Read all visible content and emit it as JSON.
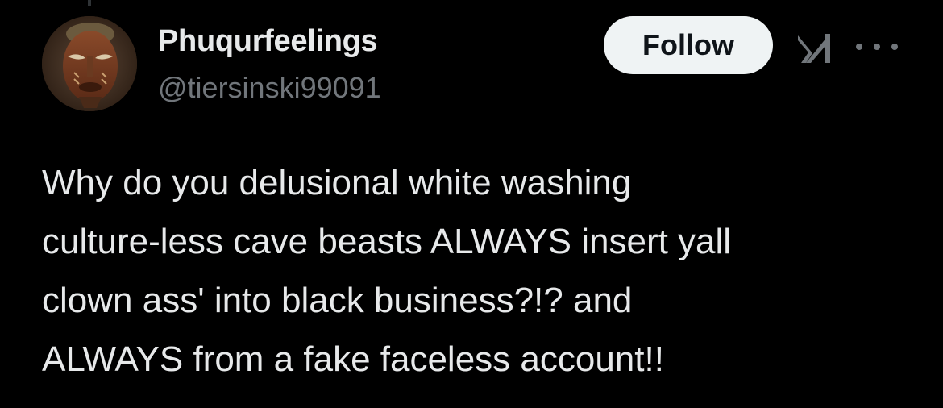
{
  "author": {
    "display_name": "Phuqurfeelings",
    "handle": "@tiersinski99091"
  },
  "actions": {
    "follow_label": "Follow",
    "grok_icon": "grok-icon",
    "more_icon": "more-options-icon"
  },
  "tweet": {
    "text": "Why do you delusional white washing\nculture-less cave beasts ALWAYS insert yall\nclown ass' into black business?!? and\nALWAYS from a fake faceless account!!"
  },
  "colors": {
    "background": "#000000",
    "primary_text": "#e7e9ea",
    "secondary_text": "#71767b",
    "follow_bg": "#eff3f4"
  }
}
